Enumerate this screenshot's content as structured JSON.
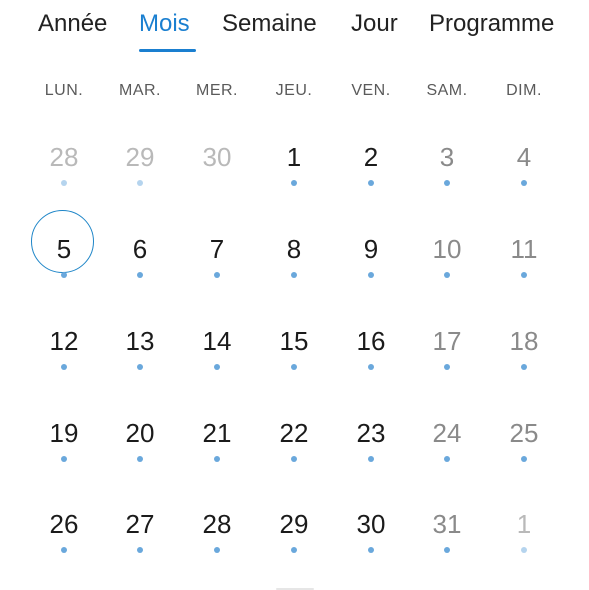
{
  "tabs": [
    {
      "label": "Année",
      "active": false
    },
    {
      "label": "Mois",
      "active": true
    },
    {
      "label": "Semaine",
      "active": false
    },
    {
      "label": "Jour",
      "active": false
    },
    {
      "label": "Programme",
      "active": false
    }
  ],
  "weekdays": [
    "LUN.",
    "MAR.",
    "MER.",
    "JEU.",
    "VEN.",
    "SAM.",
    "DIM."
  ],
  "weeks": [
    [
      {
        "day": "28",
        "outside": true,
        "has_event": true
      },
      {
        "day": "29",
        "outside": true,
        "has_event": true
      },
      {
        "day": "30",
        "outside": true,
        "has_event": false
      },
      {
        "day": "1",
        "outside": false,
        "has_event": true
      },
      {
        "day": "2",
        "outside": false,
        "has_event": true
      },
      {
        "day": "3",
        "outside": false,
        "has_event": true
      },
      {
        "day": "4",
        "outside": false,
        "has_event": true
      }
    ],
    [
      {
        "day": "5",
        "outside": false,
        "has_event": true,
        "today": true
      },
      {
        "day": "6",
        "outside": false,
        "has_event": true
      },
      {
        "day": "7",
        "outside": false,
        "has_event": true
      },
      {
        "day": "8",
        "outside": false,
        "has_event": true
      },
      {
        "day": "9",
        "outside": false,
        "has_event": true
      },
      {
        "day": "10",
        "outside": false,
        "has_event": true
      },
      {
        "day": "11",
        "outside": false,
        "has_event": true
      }
    ],
    [
      {
        "day": "12",
        "outside": false,
        "has_event": true
      },
      {
        "day": "13",
        "outside": false,
        "has_event": true
      },
      {
        "day": "14",
        "outside": false,
        "has_event": true
      },
      {
        "day": "15",
        "outside": false,
        "has_event": true
      },
      {
        "day": "16",
        "outside": false,
        "has_event": true
      },
      {
        "day": "17",
        "outside": false,
        "has_event": true
      },
      {
        "day": "18",
        "outside": false,
        "has_event": true
      }
    ],
    [
      {
        "day": "19",
        "outside": false,
        "has_event": true
      },
      {
        "day": "20",
        "outside": false,
        "has_event": true
      },
      {
        "day": "21",
        "outside": false,
        "has_event": true
      },
      {
        "day": "22",
        "outside": false,
        "has_event": true
      },
      {
        "day": "23",
        "outside": false,
        "has_event": true
      },
      {
        "day": "24",
        "outside": false,
        "has_event": true
      },
      {
        "day": "25",
        "outside": false,
        "has_event": true
      }
    ],
    [
      {
        "day": "26",
        "outside": false,
        "has_event": true
      },
      {
        "day": "27",
        "outside": false,
        "has_event": true
      },
      {
        "day": "28",
        "outside": false,
        "has_event": true
      },
      {
        "day": "29",
        "outside": false,
        "has_event": true
      },
      {
        "day": "30",
        "outside": false,
        "has_event": true
      },
      {
        "day": "31",
        "outside": false,
        "has_event": true
      },
      {
        "day": "1",
        "outside": true,
        "has_event": true
      }
    ]
  ],
  "colors": {
    "accent": "#1a7fd0",
    "today_ring": "#1f86c8",
    "event_dot": "#6aa8dc",
    "text": "#1b1b1b",
    "weekend_text": "#8a8a8a",
    "outside_text": "#b9b9b9"
  }
}
